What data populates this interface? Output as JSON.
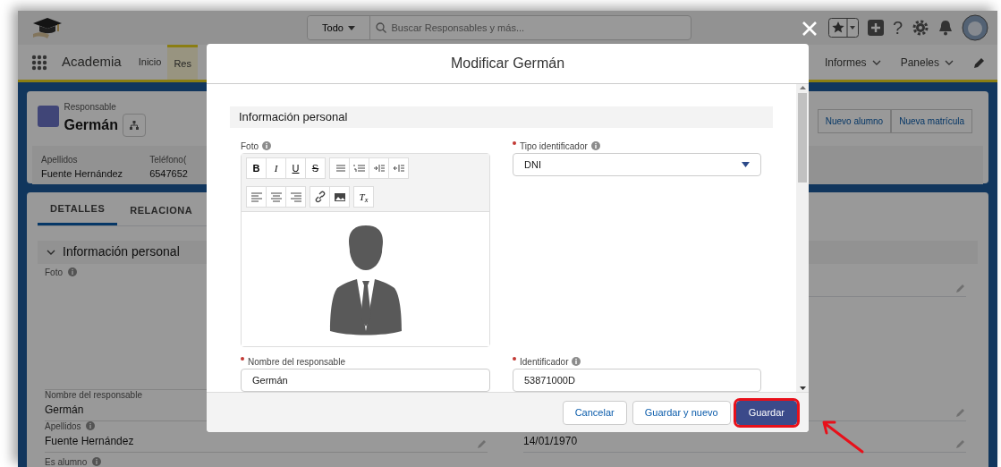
{
  "header": {
    "scope": "Todo",
    "search_placeholder": "Buscar Responsables y más...",
    "help_glyph": "?"
  },
  "nav": {
    "app_name": "Academia",
    "items": [
      {
        "label": "Inicio",
        "selected": false
      },
      {
        "label": "Res",
        "selected": true
      }
    ],
    "menus": [
      "Informes",
      "Paneles"
    ]
  },
  "record": {
    "object_label": "Responsable",
    "name": "Germán",
    "actions": [
      "Nuevo alumno",
      "Nueva matrícula"
    ],
    "highlights": [
      {
        "label": "Apellidos",
        "value": "Fuente Hernández"
      },
      {
        "label": "Teléfono(",
        "value": "6547652"
      }
    ]
  },
  "detail": {
    "tabs": [
      {
        "label": "DETALLES",
        "selected": true
      },
      {
        "label": "RELACIONA",
        "selected": false
      }
    ],
    "section": "Información personal",
    "left_fields": [
      {
        "kind": "photo",
        "label": "Foto",
        "info": true
      },
      {
        "kind": "text",
        "label": "Nombre del responsable",
        "info": false,
        "value": "Germán"
      },
      {
        "kind": "text",
        "label": "Apellidos",
        "info": true,
        "value": "Fuente Hernández"
      },
      {
        "kind": "text",
        "label": "Es alumno",
        "info": true
      }
    ],
    "right_values": [
      "14/01/1970"
    ]
  },
  "modal": {
    "title": "Modificar Germán",
    "section": "Información personal",
    "toolbar": [
      [
        {
          "kind": "bold",
          "glyph": "B"
        },
        {
          "kind": "italic",
          "glyph": "I"
        },
        {
          "kind": "underline",
          "glyph": "U"
        },
        {
          "kind": "strike",
          "glyph": "S"
        }
      ],
      [
        {
          "kind": "bullets"
        },
        {
          "kind": "numbers"
        },
        {
          "kind": "indent"
        },
        {
          "kind": "outdent"
        }
      ],
      [
        {
          "kind": "align-left"
        },
        {
          "kind": "align-center"
        },
        {
          "kind": "align-right"
        }
      ],
      [
        {
          "kind": "link"
        },
        {
          "kind": "image"
        }
      ],
      [
        {
          "kind": "clear",
          "glyph": "T$_{x}$"
        }
      ]
    ],
    "fields": [
      {
        "kind": "richtext",
        "label": "Foto",
        "required": false,
        "info": true
      },
      {
        "kind": "select",
        "label": "Tipo identificador",
        "required": true,
        "info": true,
        "value": "DNI"
      },
      {
        "kind": "text",
        "label": "Nombre del responsable",
        "required": true,
        "info": false,
        "value": "Germán"
      },
      {
        "kind": "text",
        "label": "Identificador",
        "required": true,
        "info": true,
        "value": "53871000D"
      }
    ],
    "buttons": [
      {
        "label": "Cancelar",
        "kind": "neutral",
        "highlighted": false
      },
      {
        "label": "Guardar y nuevo",
        "kind": "neutral",
        "highlighted": false
      },
      {
        "label": "Guardar",
        "kind": "brand",
        "highlighted": true
      }
    ]
  }
}
